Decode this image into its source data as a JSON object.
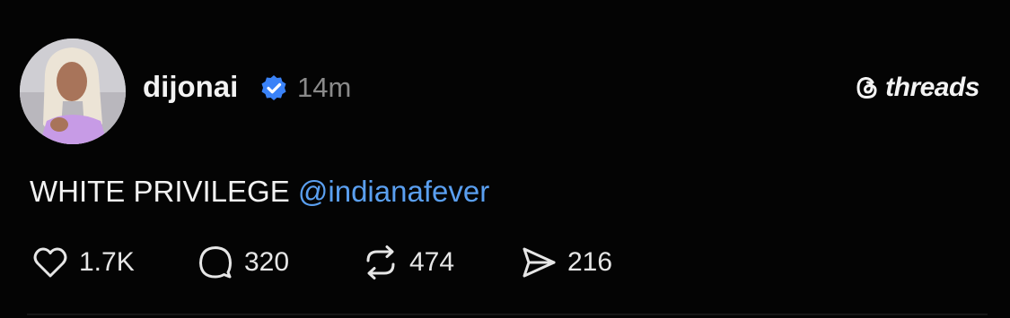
{
  "post": {
    "username": "dijonai",
    "verified": true,
    "timestamp": "14m",
    "text": "WHITE PRIVILEGE",
    "mention": "@indianafever"
  },
  "brand": {
    "name": "threads",
    "icon": "threads-logo-icon"
  },
  "actions": [
    {
      "icon": "heart-icon",
      "count": "1.7K"
    },
    {
      "icon": "comment-bubble-icon",
      "count": "320"
    },
    {
      "icon": "repost-icon",
      "count": "474"
    },
    {
      "icon": "share-send-icon",
      "count": "216"
    }
  ],
  "colors": {
    "background": "#040404",
    "text": "#f2f2f2",
    "muted": "#8a8a8a",
    "mention": "#5a9ff0",
    "verified_badge": "#3a82f7"
  }
}
